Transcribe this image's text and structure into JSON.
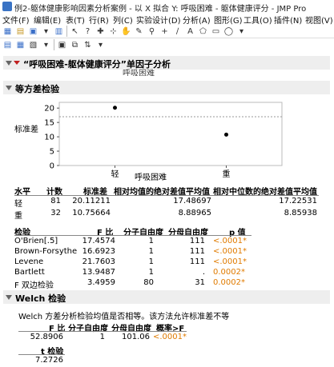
{
  "window": {
    "title": "例2-躯体健康影响因素分析案例 - 以 X 拟合 Y: 呼吸困难 - 躯体健康评分 - JMP Pro"
  },
  "menu": [
    "文件(F)",
    "编辑(E)",
    "表(T)",
    "行(R)",
    "列(C)",
    "实验设计(D)",
    "分析(A)",
    "图形(G)",
    "工具(O)",
    "插件(N)",
    "视图(V)"
  ],
  "report": {
    "title": "“呼吸困难-躯体健康评分”单因子分析",
    "partial_label": "呼吸困难",
    "section_title": "等方差检验",
    "plot": {
      "ylabel": "标准差",
      "xlabel": "呼吸困难",
      "yticks": [
        "20",
        "15",
        "10",
        "5",
        "0"
      ]
    },
    "sd_table": {
      "headers": [
        "水平",
        "计数",
        "标准差",
        "相对均值的绝对差值平均值",
        "相对中位数的绝对差值平均值"
      ],
      "rows": [
        [
          "轻",
          "81",
          "20.11211",
          "17.48697",
          "17.22531"
        ],
        [
          "重",
          "32",
          "10.75664",
          "8.88965",
          "8.85938"
        ]
      ]
    },
    "test_table": {
      "headers": [
        "检验",
        "F 比",
        "分子自由度",
        "分母自由度",
        "p 值"
      ],
      "rows": [
        [
          "O'Brien[.5]",
          "17.4574",
          "1",
          "111",
          "<.0001*"
        ],
        [
          "Brown-Forsythe",
          "16.6923",
          "1",
          "111",
          "<.0001*"
        ],
        [
          "Levene",
          "21.7603",
          "1",
          "111",
          "<.0001*"
        ],
        [
          "Bartlett",
          "13.9487",
          "1",
          ".",
          "0.0002*"
        ],
        [
          "F 双边检验",
          "3.4959",
          "80",
          "31",
          "0.0002*"
        ]
      ]
    },
    "welch": {
      "title": "Welch 检验",
      "description": "Welch 方差分析检验均值是否相等。该方法允许标准差不等",
      "headers": [
        "F 比",
        "分子自由度",
        "分母自由度",
        "概率>F"
      ],
      "row": [
        "52.8906",
        "1",
        "101.06",
        "<.0001*"
      ],
      "t_header": "t 检验",
      "t_value": "7.2726"
    }
  },
  "chart_data": {
    "type": "scatter",
    "title": "",
    "xlabel": "呼吸困难",
    "ylabel": "标准差",
    "categories": [
      "轻",
      "重"
    ],
    "values": [
      20.11211,
      10.75664
    ],
    "reference_line": 17.0,
    "ylim": [
      0,
      22
    ],
    "yticks": [
      0,
      5,
      10,
      15,
      20
    ],
    "grid": false
  }
}
